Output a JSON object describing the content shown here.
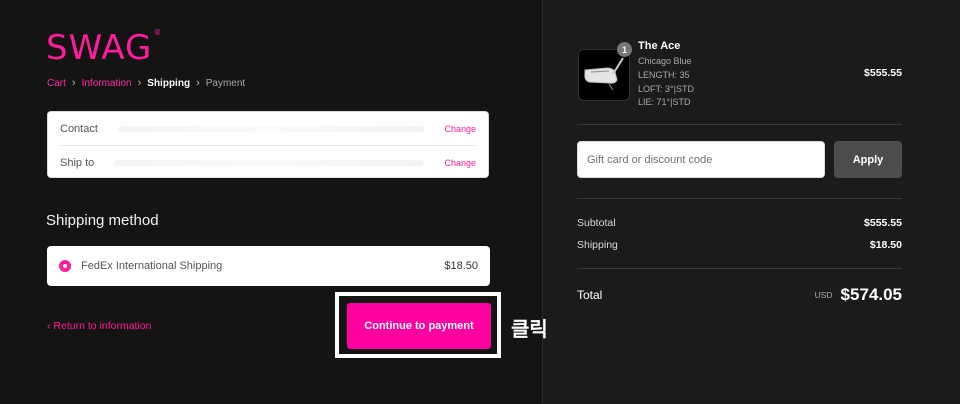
{
  "brand": {
    "logo_text": "SWAG",
    "logo_mark": "®",
    "accent": "#ff1e9a"
  },
  "breadcrumb": {
    "items": [
      {
        "label": "Cart",
        "state": "link"
      },
      {
        "label": "Information",
        "state": "link"
      },
      {
        "label": "Shipping",
        "state": "current"
      },
      {
        "label": "Payment",
        "state": "upcoming"
      }
    ],
    "separator_icon": "chevron-right-icon"
  },
  "review": {
    "contact_label": "Contact",
    "contact_change": "Change",
    "ship_to_label": "Ship to",
    "ship_to_change": "Change"
  },
  "shipping_method": {
    "heading": "Shipping method",
    "option_name": "FedEx International Shipping",
    "option_price": "$18.50",
    "selected": true
  },
  "actions": {
    "return_label": "Return to information",
    "return_icon": "chevron-left-icon",
    "continue_label": "Continue to payment",
    "annotation_label": "클릭"
  },
  "order": {
    "product": {
      "quantity": "1",
      "name": "The Ace",
      "variant": "Chicago Blue",
      "length": "LENGTH: 35",
      "loft": "LOFT: 3°|STD",
      "lie": "LIE: 71°|STD",
      "price": "$555.55",
      "image_icon": "putter-icon"
    },
    "discount": {
      "placeholder": "Gift card or discount code",
      "apply_label": "Apply"
    },
    "summary": {
      "subtotal_label": "Subtotal",
      "subtotal_value": "$555.55",
      "shipping_label": "Shipping",
      "shipping_value": "$18.50",
      "total_label": "Total",
      "currency": "USD",
      "total_value": "$574.05"
    }
  }
}
